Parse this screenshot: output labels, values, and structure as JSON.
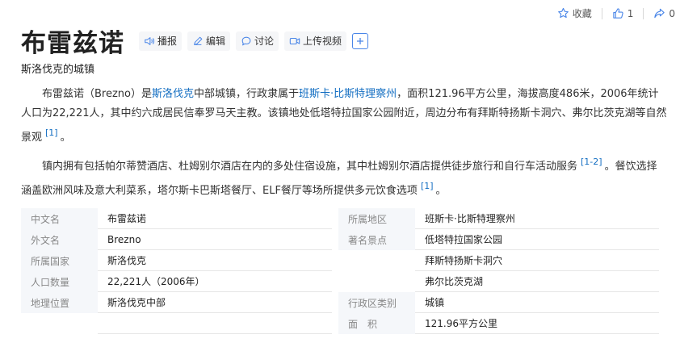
{
  "actions": {
    "collect": "收藏",
    "like_count": "1",
    "share_count": "0"
  },
  "title": "布雷兹诺",
  "toolbar": {
    "broadcast": "播报",
    "edit": "编辑",
    "discuss": "讨论",
    "upload_video": "上传视频"
  },
  "subtitle": "斯洛伐克的城镇",
  "paragraph1": {
    "t1": "布雷兹诺（Brezno）是",
    "link1": "斯洛伐克",
    "t2": "中部城镇，行政隶属于",
    "link2": "班斯卡·比斯特理察州",
    "t3": "，面积121.96平方公里，海拔高度486米，2006年统计人口为22,221人，其中约六成居民信奉罗马天主教。该镇地处低塔特拉国家公园附近，周边分布有拜斯特扬斯卡洞穴、弗尔比茨克湖等自然景观",
    "ref": "[1]",
    "end": "。"
  },
  "paragraph2": {
    "t1": "镇内拥有包括帕尔蒂赞酒店、杜姆别尔酒店在内的多处住宿设施，其中杜姆别尔酒店提供徒步旅行和自行车活动服务",
    "ref1": "[1-2]",
    "t2": "。餐饮选择涵盖欧洲风味及意大利菜系，塔尔斯卡巴斯塔餐厅、ELF餐厅等场所提供多元饮食选项",
    "ref2": "[1]",
    "end": "。"
  },
  "info": {
    "left": [
      {
        "label": "中文名",
        "value": "布雷兹诺"
      },
      {
        "label": "外文名",
        "value": "Brezno"
      },
      {
        "label": "所属国家",
        "value": "斯洛伐克"
      },
      {
        "label": "人口数量",
        "value": "22,221人（2006年）"
      },
      {
        "label": "地理位置",
        "value": "斯洛伐克中部"
      }
    ],
    "right": [
      {
        "label": "所属地区",
        "value": "班斯卡·比斯特理察州"
      },
      {
        "label": "著名景点",
        "value": "低塔特拉国家公园"
      },
      {
        "label": "",
        "value": "拜斯特扬斯卡洞穴"
      },
      {
        "label": "",
        "value": "弗尔比茨克湖"
      },
      {
        "label": "行政区类别",
        "value": "城镇"
      },
      {
        "label": "面　积",
        "value": "121.96平方公里"
      }
    ]
  }
}
